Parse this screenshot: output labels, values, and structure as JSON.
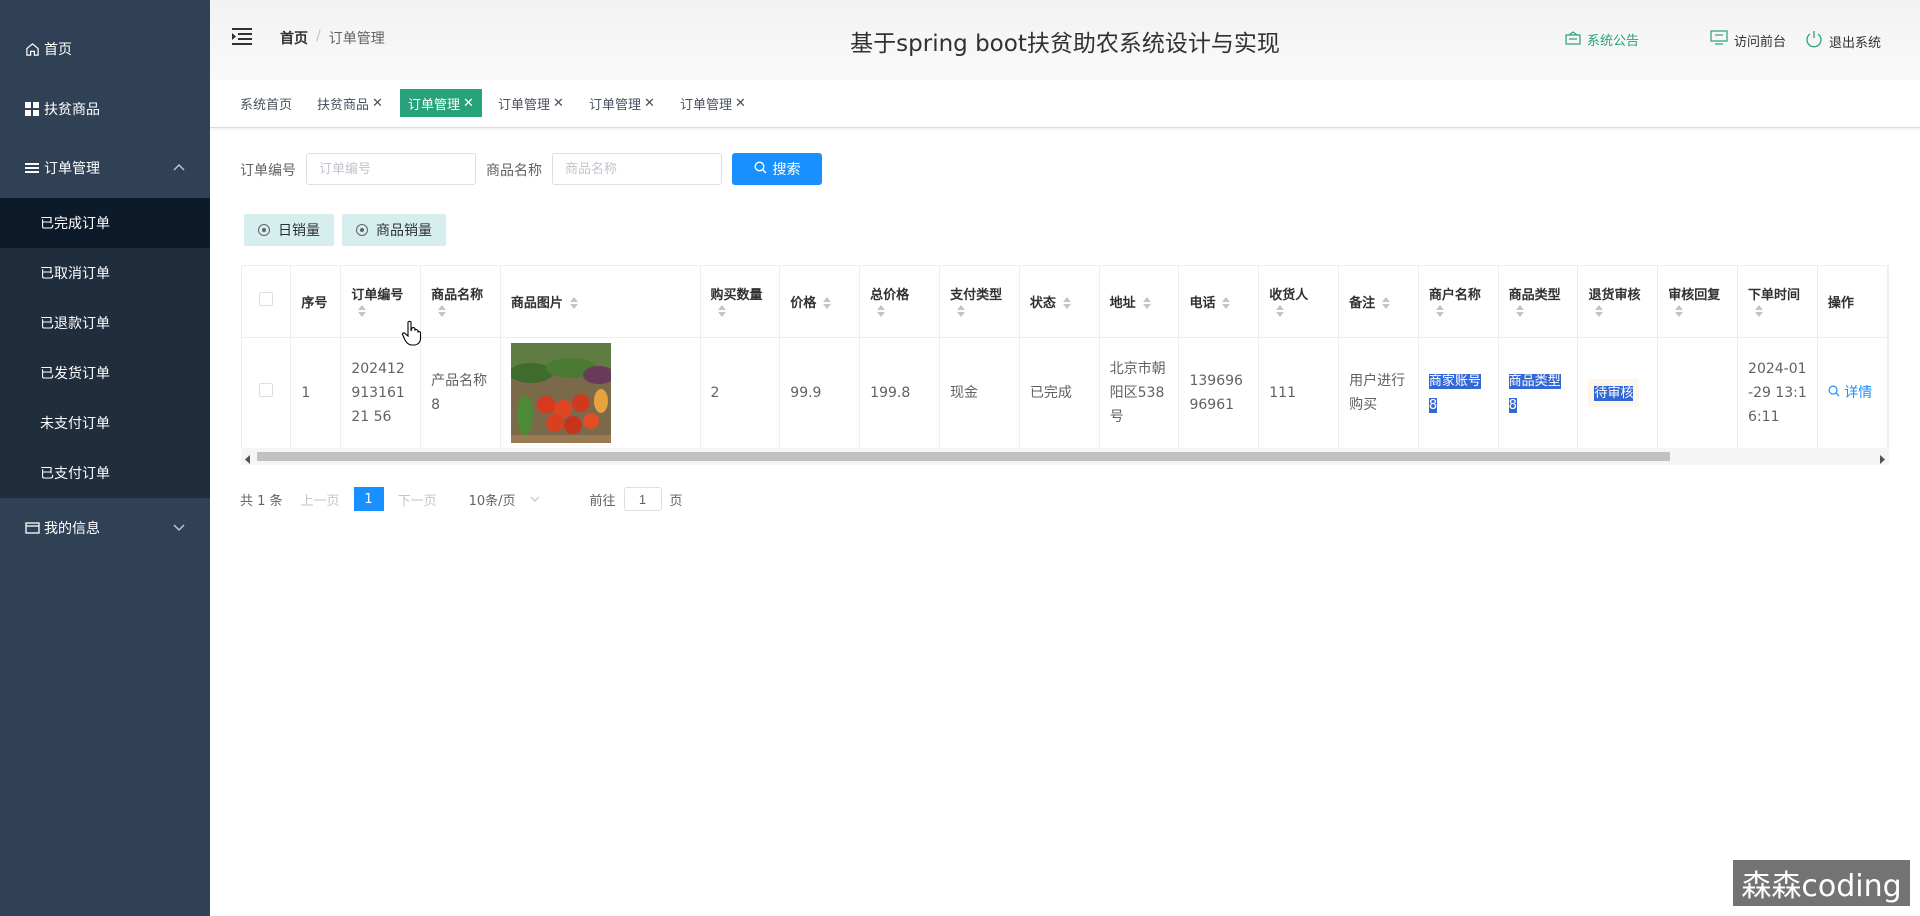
{
  "sidebar": {
    "home": "首页",
    "products": "扶贫商品",
    "orders": "订单管理",
    "order_items": [
      "已完成订单",
      "已取消订单",
      "已退款订单",
      "已发货订单",
      "未支付订单",
      "已支付订单"
    ],
    "my_info": "我的信息"
  },
  "header": {
    "breadcrumb_home": "首页",
    "breadcrumb_sep": "/",
    "breadcrumb_current": "订单管理",
    "title": "基于spring boot扶贫助农系统设计与实现",
    "notice": "系统公告",
    "front": "访问前台",
    "logout": "退出系统"
  },
  "tags": [
    {
      "label": "系统首页",
      "closable": false,
      "active": false
    },
    {
      "label": "扶贫商品",
      "closable": true,
      "active": false
    },
    {
      "label": "订单管理",
      "closable": true,
      "active": true
    },
    {
      "label": "订单管理",
      "closable": true,
      "active": false
    },
    {
      "label": "订单管理",
      "closable": true,
      "active": false
    },
    {
      "label": "订单管理",
      "closable": true,
      "active": false
    }
  ],
  "search": {
    "order_no_label": "订单编号",
    "order_no_placeholder": "订单编号",
    "product_label": "商品名称",
    "product_placeholder": "商品名称",
    "button": "搜索"
  },
  "chart_buttons": {
    "daily": "日销量",
    "product": "商品销量"
  },
  "table": {
    "headers": [
      "序号",
      "订单编号",
      "商品名称",
      "商品图片",
      "购买数量",
      "价格",
      "总价格",
      "支付类型",
      "状态",
      "地址",
      "电话",
      "收货人",
      "备注",
      "商户名称",
      "商品类型",
      "退货审核",
      "审核回复",
      "下单时间",
      "操作"
    ],
    "row": {
      "index": "1",
      "order_no": "20241291316121 56",
      "product": "产品名称8",
      "quantity": "2",
      "price": "99.9",
      "total": "199.8",
      "pay_type": "现金",
      "status": "已完成",
      "address": "北京市朝阳区538号",
      "phone": "13969696961",
      "receiver": "111",
      "remark": "用户进行购买",
      "merchant": "商家账号8",
      "category": "商品类型8",
      "return_review": "待审核",
      "review_reply": "",
      "order_time": "2024-01-29 13:16:11",
      "action": "详情"
    }
  },
  "pager": {
    "total": "共 1 条",
    "prev": "上一页",
    "current": "1",
    "next": "下一页",
    "size": "10条/页",
    "goto": "前往",
    "goto_value": "1",
    "page_unit": "页"
  },
  "watermark": "森森coding"
}
